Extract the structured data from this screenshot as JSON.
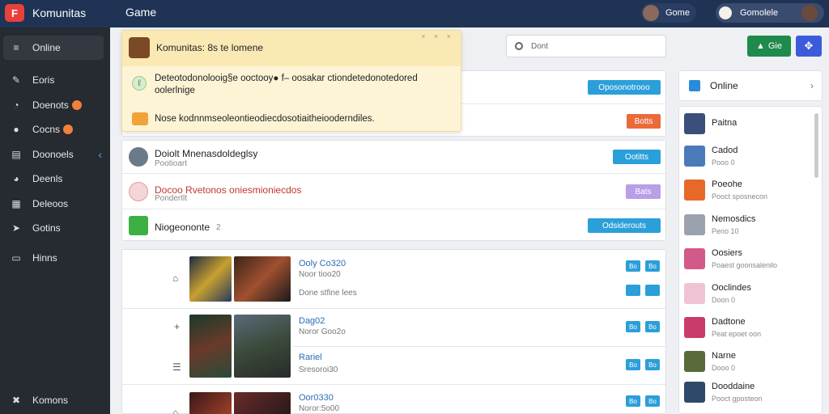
{
  "topbar": {
    "logo": "F",
    "brand": "Komunitas",
    "title": "Game",
    "user_left": "Gome",
    "user_right": "Gomolele"
  },
  "sidebar": {
    "items": [
      {
        "label": "Online",
        "icon": "≡"
      },
      {
        "label": "Eoris",
        "icon": "✎"
      },
      {
        "label": "Doenots",
        "icon": "◔"
      },
      {
        "label": "Cocns",
        "icon": "●"
      },
      {
        "label": "Doonoels",
        "icon": "▤"
      },
      {
        "label": "Deenls",
        "icon": "◕"
      },
      {
        "label": "Deleoos",
        "icon": "▦"
      },
      {
        "label": "Gotins",
        "icon": "➤"
      },
      {
        "label": "Hinns",
        "icon": "▭"
      }
    ],
    "bottom": {
      "label": "Komons",
      "icon": "✖"
    }
  },
  "search": {
    "placeholder": "Dont"
  },
  "actions": {
    "green_label": "Gie",
    "blue_icon": "✥"
  },
  "notification": {
    "title": "Komunitas: 8s te lomene",
    "close": "× ×  ×",
    "line1": "Deteotodonolooig§e ooctooy● f– oosakar ctiondetedonotedored oolerlnige",
    "line2": "Nose kodnnmseoleontieodiecdosotiaitheiooderndiles."
  },
  "communities": [
    {
      "title": "Doiolt Mnenasdoldeglsy",
      "sub": "Pootioart",
      "button": "Ootitts"
    },
    {
      "title": "Docoo  Rvetonos oniesmioniecdos",
      "sub": "Pondertlt",
      "button": "Bats"
    },
    {
      "title": "Niogeononte",
      "sub": "",
      "count": "2",
      "button": "Odsiderouts"
    }
  ],
  "top_buttons": {
    "first": "Oposonotrooo",
    "second": "Botts"
  },
  "games": [
    {
      "title": "Ooly Co320",
      "sub": "Noor tioo20",
      "sub2": "Done stfine lees",
      "btn_a": "Bo",
      "btn_b": "Bo"
    },
    {
      "title": "Dag02",
      "sub": "Noror Goo2o",
      "sub2": "",
      "btn_a": "Bo",
      "btn_b": "Bo"
    },
    {
      "title": "Rariel",
      "sub": "Sresoroi30",
      "sub2": "",
      "btn_a": "Bo",
      "btn_b": "Bo"
    },
    {
      "title": "Oor0330",
      "sub": "Noror:5o00",
      "sub2": "",
      "btn_a": "Bo",
      "btn_b": "Bo"
    }
  ],
  "online": {
    "title": "Online"
  },
  "friends": [
    {
      "name": "Paitna",
      "status": "",
      "color": "#3a4f7a"
    },
    {
      "name": "Cadod",
      "status": "Pooo  0",
      "color": "#4a7ab8"
    },
    {
      "name": "Poeohe",
      "status": "Pooct sposnecon",
      "color": "#e8682a"
    },
    {
      "name": "Nemosdics",
      "status": "Peno 10",
      "color": "#9aa3ad"
    },
    {
      "name": "Oosiers",
      "status": "Poaest goonsalenilo",
      "color": "#d25a8a"
    },
    {
      "name": "Ooclindes",
      "status": "Doon  0",
      "color": "#f0c3d4"
    },
    {
      "name": "Dadtone",
      "status": "Peat epoet oon",
      "color": "#c93b6a"
    },
    {
      "name": "Narne",
      "status": "Dooo 0",
      "color": "#5a6a3a"
    },
    {
      "name": "Dooddaine",
      "status": "Pooct gposteon",
      "color": "#2e4a6a"
    }
  ]
}
